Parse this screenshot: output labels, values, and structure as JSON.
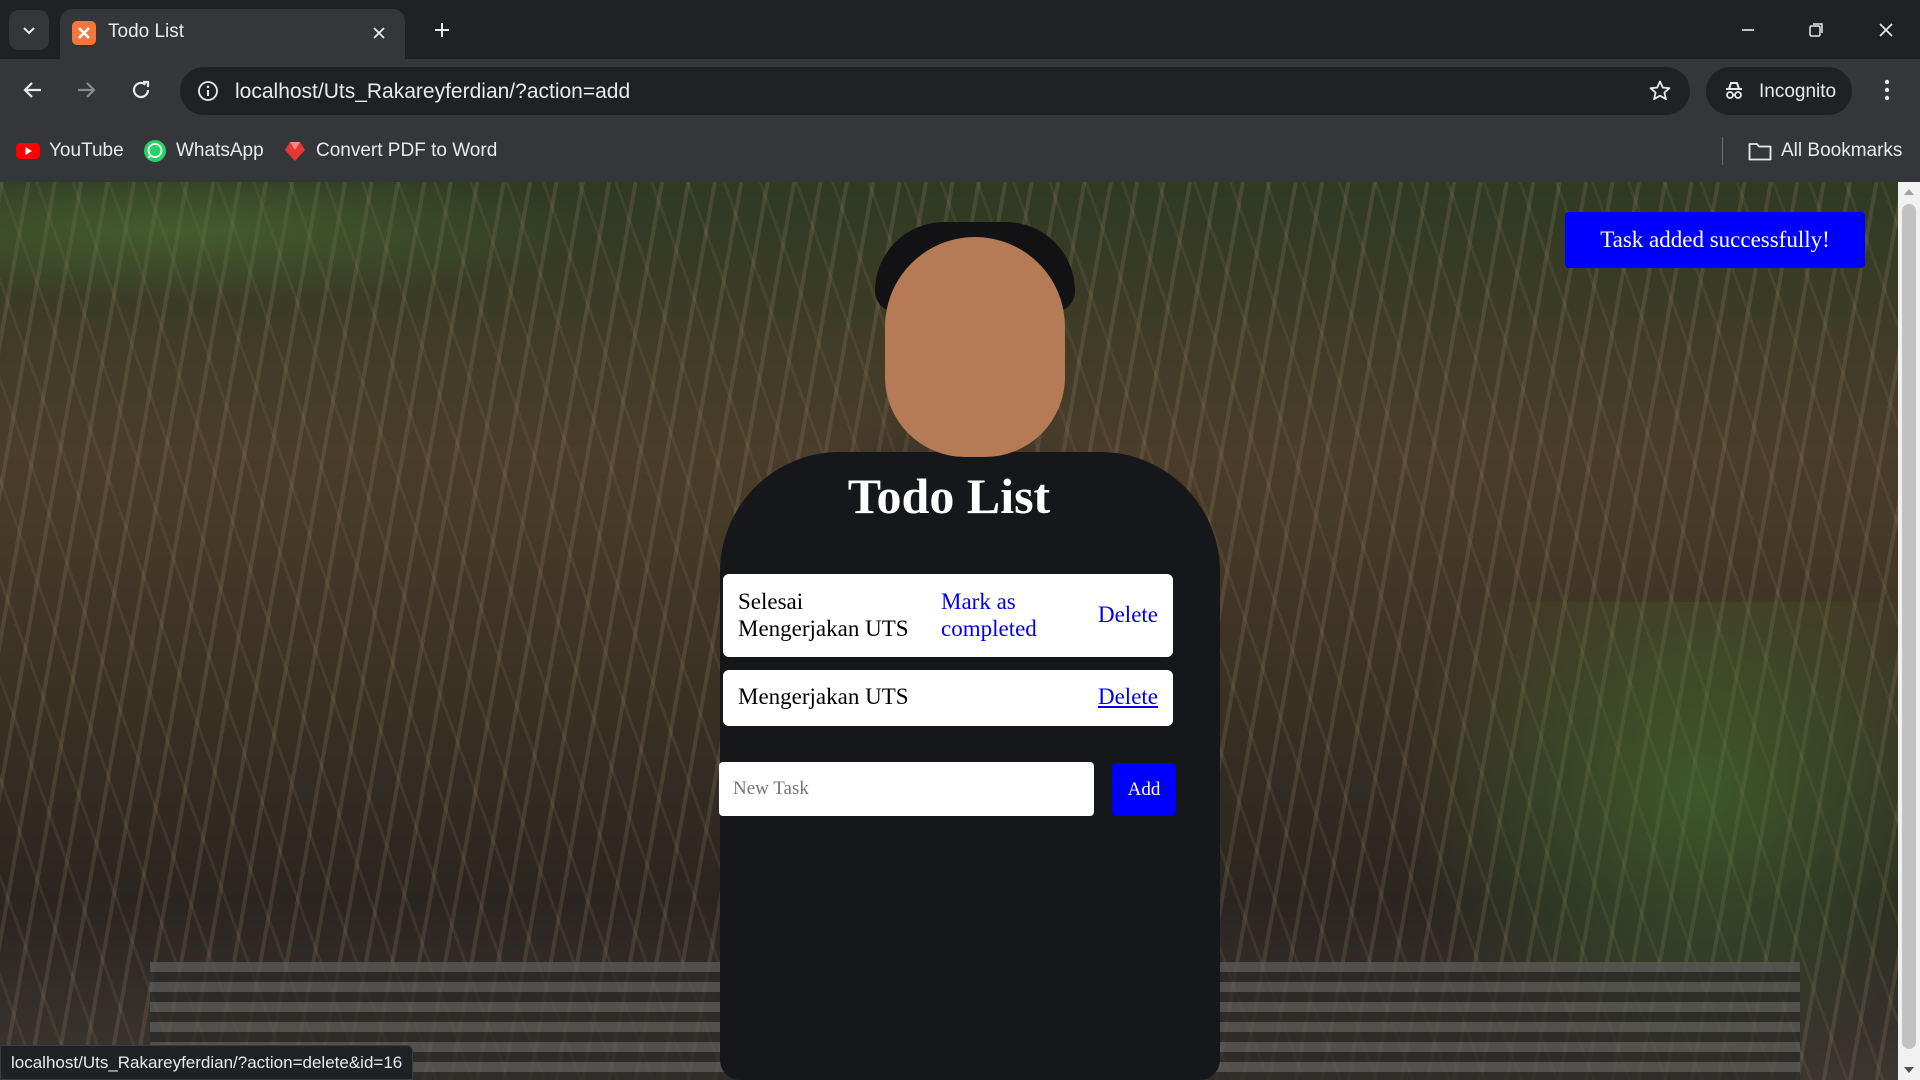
{
  "browser": {
    "tab": {
      "title": "Todo List",
      "favicon": "xampp-icon"
    },
    "address": {
      "url": "localhost/Uts_Rakareyferdian/?action=add"
    },
    "incognito_label": "Incognito",
    "bookmarks": [
      {
        "label": "YouTube",
        "icon": "youtube-icon"
      },
      {
        "label": "WhatsApp",
        "icon": "whatsapp-icon"
      },
      {
        "label": "Convert PDF to Word",
        "icon": "pdf-icon"
      }
    ],
    "all_bookmarks_label": "All Bookmarks",
    "status_url": "localhost/Uts_Rakareyferdian/?action=delete&id=16"
  },
  "app": {
    "title": "Todo List",
    "toast": "Task added successfully!",
    "tasks": [
      {
        "text_line1": "Selesai",
        "text_line2": "Mengerjakan UTS",
        "mark_line1": "Mark as",
        "mark_line2": "completed",
        "delete": "Delete"
      },
      {
        "text": "Mengerjakan UTS",
        "delete": "Delete"
      }
    ],
    "form": {
      "placeholder": "New Task",
      "value": "",
      "button": "Add"
    }
  },
  "colors": {
    "accent_blue": "#0000ff",
    "link_blue": "#0000ee",
    "chrome_dark": "#202124",
    "chrome_toolbar": "#35363a"
  }
}
